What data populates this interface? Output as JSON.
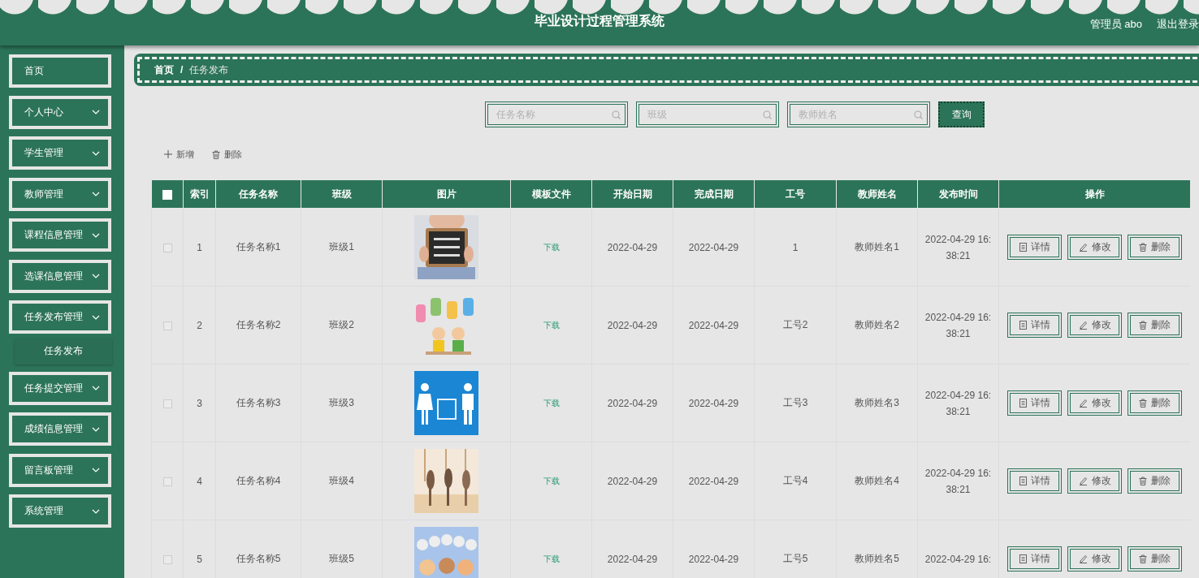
{
  "header": {
    "title": "毕业设计过程管理系统",
    "user": "管理员 abo",
    "logout": "退出登录"
  },
  "sidebar": {
    "items": [
      {
        "label": "首页",
        "kind": "link"
      },
      {
        "label": "个人中心",
        "kind": "menu"
      },
      {
        "label": "学生管理",
        "kind": "menu"
      },
      {
        "label": "教师管理",
        "kind": "menu"
      },
      {
        "label": "课程信息管理",
        "kind": "menu"
      },
      {
        "label": "选课信息管理",
        "kind": "menu"
      },
      {
        "label": "任务发布管理",
        "kind": "menu",
        "children": [
          {
            "label": "任务发布",
            "selected": true
          }
        ]
      },
      {
        "label": "任务提交管理",
        "kind": "menu"
      },
      {
        "label": "成绩信息管理",
        "kind": "menu"
      },
      {
        "label": "留言板管理",
        "kind": "menu"
      },
      {
        "label": "系统管理",
        "kind": "menu"
      }
    ]
  },
  "breadcrumb": {
    "items": [
      "首页",
      "任务发布"
    ],
    "separator": "/"
  },
  "search": {
    "fields": [
      {
        "placeholder": "任务名称"
      },
      {
        "placeholder": "班级"
      },
      {
        "placeholder": "教师姓名"
      }
    ],
    "button": "查询"
  },
  "toolbar": [
    {
      "label": "新增",
      "kind": "add"
    },
    {
      "label": "删除",
      "kind": "delete"
    }
  ],
  "table": {
    "select_all_checked": false,
    "columns": [
      "索引",
      "任务名称",
      "班级",
      "图片",
      "模板文件",
      "开始日期",
      "完成日期",
      "工号",
      "教师姓名",
      "发布时间",
      "操作"
    ],
    "rows": [
      {
        "checked": false,
        "index": "1",
        "name": "任务名称1",
        "class": "班级1",
        "template": "下载",
        "start": "2022-04-29",
        "end": "2022-04-29",
        "staff_no": "1",
        "teacher": "教师姓名1",
        "published": "2022-04-29 16:38:21",
        "actions": [
          {
            "label": "详情",
            "kind": "detail"
          },
          {
            "label": "修改",
            "kind": "edit"
          },
          {
            "label": "删除",
            "kind": "delete"
          }
        ]
      },
      {
        "checked": false,
        "index": "2",
        "name": "任务名称2",
        "class": "班级2",
        "template": "下载",
        "start": "2022-04-29",
        "end": "2022-04-29",
        "staff_no": "工号2",
        "teacher": "教师姓名2",
        "published": "2022-04-29 16:38:21",
        "actions": [
          {
            "label": "详情",
            "kind": "detail"
          },
          {
            "label": "修改",
            "kind": "edit"
          },
          {
            "label": "删除",
            "kind": "delete"
          }
        ]
      },
      {
        "checked": false,
        "index": "3",
        "name": "任务名称3",
        "class": "班级3",
        "template": "下载",
        "start": "2022-04-29",
        "end": "2022-04-29",
        "staff_no": "工号3",
        "teacher": "教师姓名3",
        "published": "2022-04-29 16:38:21",
        "actions": [
          {
            "label": "详情",
            "kind": "detail"
          },
          {
            "label": "修改",
            "kind": "edit"
          },
          {
            "label": "删除",
            "kind": "delete"
          }
        ]
      },
      {
        "checked": false,
        "index": "4",
        "name": "任务名称4",
        "class": "班级4",
        "template": "下载",
        "start": "2022-04-29",
        "end": "2022-04-29",
        "staff_no": "工号4",
        "teacher": "教师姓名4",
        "published": "2022-04-29 16:38:21",
        "actions": [
          {
            "label": "详情",
            "kind": "detail"
          },
          {
            "label": "修改",
            "kind": "edit"
          },
          {
            "label": "删除",
            "kind": "delete"
          }
        ]
      },
      {
        "checked": false,
        "index": "5",
        "name": "任务名称5",
        "class": "班级5",
        "template": "下载",
        "start": "2022-04-29",
        "end": "2022-04-29",
        "staff_no": "工号5",
        "teacher": "教师姓名5",
        "published": "2022-04-29 16:",
        "actions": [
          {
            "label": "详情",
            "kind": "detail"
          },
          {
            "label": "修改",
            "kind": "edit"
          },
          {
            "label": "删除",
            "kind": "delete"
          }
        ]
      }
    ]
  }
}
